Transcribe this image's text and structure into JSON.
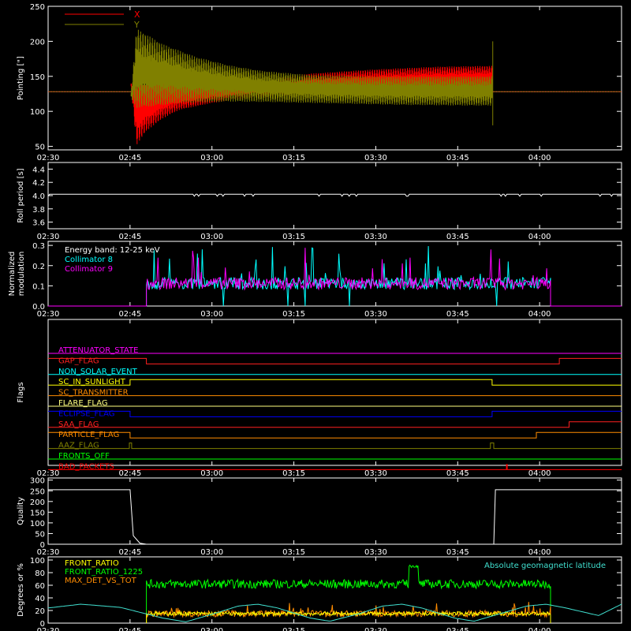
{
  "chart_data": [
    {
      "type": "line",
      "ylabel": "Pointing [\"]",
      "ylim": [
        45,
        250
      ],
      "yticks": [
        50,
        100,
        150,
        200,
        250
      ],
      "grid": false,
      "legend": "top-left",
      "series": [
        {
          "name": "X",
          "color": "#ff0000",
          "min": [
            [
              2.752,
              140
            ],
            [
              2.77,
              52
            ],
            [
              2.8,
              72
            ],
            [
              2.85,
              90
            ],
            [
              2.9,
              102
            ],
            [
              3.0,
              112
            ],
            [
              3.1,
              118
            ],
            [
              3.3,
              122
            ],
            [
              3.5,
              126
            ],
            [
              3.7,
              128
            ],
            [
              3.855,
              129
            ]
          ],
          "max": [
            [
              2.752,
              140
            ],
            [
              2.77,
              138
            ],
            [
              2.85,
              140
            ],
            [
              3.0,
              141
            ],
            [
              3.15,
              146
            ],
            [
              3.3,
              154
            ],
            [
              3.5,
              160
            ],
            [
              3.7,
              164
            ],
            [
              3.855,
              165
            ]
          ]
        },
        {
          "name": "Y",
          "color": "#808000",
          "min": [
            [
              2.752,
              120
            ],
            [
              2.77,
              105
            ],
            [
              2.9,
              112
            ],
            [
              3.05,
              114
            ],
            [
              3.2,
              113
            ],
            [
              3.4,
              111
            ],
            [
              3.6,
              109
            ],
            [
              3.855,
              108
            ]
          ],
          "max": [
            [
              2.752,
              120
            ],
            [
              2.77,
              218
            ],
            [
              2.85,
              196
            ],
            [
              2.95,
              178
            ],
            [
              3.05,
              166
            ],
            [
              3.15,
              158
            ],
            [
              3.3,
              152
            ],
            [
              3.5,
              150
            ],
            [
              3.7,
              150
            ],
            [
              3.855,
              150
            ]
          ]
        }
      ],
      "flat_value": 128,
      "xaxis_labels": [
        "02:30",
        "02:45",
        "03:00",
        "03:15",
        "03:30",
        "03:45",
        "04:00"
      ]
    },
    {
      "type": "line",
      "ylabel": "Roll period [s]",
      "ylim": [
        3.5,
        4.5
      ],
      "yticks": [
        3.6,
        3.8,
        4.0,
        4.2,
        4.4
      ],
      "series": [
        {
          "name": "",
          "color": "#ffffff",
          "x_range": [
            "02:30",
            "04:15"
          ],
          "value": 4.02
        }
      ],
      "xaxis_labels": [
        "02:30",
        "02:45",
        "03:00",
        "03:15",
        "03:30",
        "03:45",
        "04:00"
      ]
    },
    {
      "type": "line",
      "ylabel": "Normalized modulation",
      "ylim": [
        0,
        0.32
      ],
      "yticks": [
        0.0,
        0.1,
        0.2,
        0.3
      ],
      "annotation": "Energy band: 12-25 keV",
      "legend": "top-left",
      "series": [
        {
          "name": "Collimator 8",
          "color": "#00ffff",
          "baseline": 0.092,
          "x_range": [
            "02:48",
            "04:02"
          ]
        },
        {
          "name": "Collimator 9",
          "color": "#ff00ff",
          "baseline": 0.092,
          "x_range": [
            "02:48",
            "04:02"
          ]
        }
      ],
      "xaxis_labels": [
        "02:30",
        "02:45",
        "03:00",
        "03:15",
        "03:30",
        "03:45",
        "04:00"
      ]
    },
    {
      "type": "line",
      "ylabel": "Flags",
      "flags": [
        {
          "name": "ATTENUATOR_STATE",
          "color": "#ff00ff",
          "states": [
            [
              2.5,
              0
            ]
          ]
        },
        {
          "name": "GAP_FLAG",
          "color": "#ff2020",
          "states": [
            [
              2.5,
              1
            ],
            [
              2.8,
              0
            ],
            [
              4.06,
              1
            ]
          ]
        },
        {
          "name": "NON_SOLAR_EVENT",
          "color": "#00ffff",
          "states": [
            [
              2.5,
              0
            ]
          ]
        },
        {
          "name": "SC_IN_SUNLIGHT",
          "color": "#ffff00",
          "states": [
            [
              2.5,
              0
            ],
            [
              2.75,
              1
            ],
            [
              3.855,
              0
            ]
          ]
        },
        {
          "name": "SC_TRANSMITTER",
          "color": "#ff8c00",
          "states": [
            [
              2.5,
              0
            ]
          ]
        },
        {
          "name": "FLARE_FLAG",
          "color": "#ffff80",
          "states": [
            [
              2.5,
              0
            ]
          ]
        },
        {
          "name": "ECLIPSE_FLAG",
          "color": "#0000ff",
          "states": [
            [
              2.5,
              1
            ],
            [
              2.75,
              0
            ],
            [
              3.855,
              1
            ]
          ]
        },
        {
          "name": "SAA_FLAG",
          "color": "#ff2020",
          "states": [
            [
              2.5,
              0
            ],
            [
              4.09,
              1
            ]
          ]
        },
        {
          "name": "PARTICLE_FLAG",
          "color": "#ff8c00",
          "states": [
            [
              2.5,
              1
            ],
            [
              2.75,
              0
            ],
            [
              3.99,
              1
            ]
          ]
        },
        {
          "name": "AAZ_FLAG",
          "color": "#808000",
          "states": [
            [
              2.5,
              0
            ],
            [
              2.748,
              1
            ],
            [
              2.755,
              0
            ],
            [
              3.85,
              1
            ],
            [
              3.86,
              0
            ]
          ]
        },
        {
          "name": "FRONTS_OFF",
          "color": "#00ff00",
          "states": [
            [
              2.5,
              0
            ]
          ]
        },
        {
          "name": "BAD_PACKETS",
          "color": "#ff0000",
          "states": [
            [
              2.5,
              0
            ]
          ],
          "spikes": [
            3.9
          ]
        }
      ],
      "xaxis_labels": [
        "02:30",
        "02:45",
        "03:00",
        "03:15",
        "03:30",
        "03:45",
        "04:00"
      ]
    },
    {
      "type": "line",
      "ylabel": "Quality",
      "ylim": [
        0,
        310
      ],
      "yticks": [
        0,
        50,
        100,
        150,
        200,
        250,
        300
      ],
      "series": [
        {
          "name": "",
          "color": "#ffffff",
          "points": [
            [
              2.5,
              255
            ],
            [
              2.75,
              255
            ],
            [
              2.76,
              40
            ],
            [
              2.78,
              5
            ],
            [
              2.8,
              0
            ],
            [
              3.86,
              0
            ],
            [
              3.865,
              255
            ],
            [
              4.25,
              255
            ]
          ]
        }
      ],
      "xaxis_labels": [
        "02:30",
        "02:45",
        "03:00",
        "03:15",
        "03:30",
        "03:45",
        "04:00"
      ]
    },
    {
      "type": "line",
      "ylabel": "Degrees or %",
      "ylim": [
        0,
        105
      ],
      "yticks": [
        0,
        20,
        40,
        60,
        80,
        100
      ],
      "legend": "top-left",
      "series": [
        {
          "name": "FRONT_RATIO",
          "color": "#ffff00",
          "level": 15,
          "x_range": [
            "02:48",
            "04:02"
          ]
        },
        {
          "name": "FRONT_RATIO_1225",
          "color": "#00ff00",
          "level": 62,
          "x_range": [
            "02:48",
            "04:02"
          ],
          "bump": [
            [
              3.6,
              3.63,
              90
            ]
          ]
        },
        {
          "name": "MAX_DET_VS_TOT",
          "color": "#ff8c00",
          "level": 14,
          "x_range": [
            "02:48",
            "04:02"
          ]
        },
        {
          "name": "Absolute geomagnetic latitude",
          "color": "#40e0d0",
          "points": [
            [
              2.5,
              24
            ],
            [
              2.6,
              30
            ],
            [
              2.72,
              25
            ],
            [
              2.85,
              8
            ],
            [
              2.92,
              2
            ],
            [
              3.0,
              14
            ],
            [
              3.08,
              27
            ],
            [
              3.14,
              30
            ],
            [
              3.2,
              24
            ],
            [
              3.3,
              8
            ],
            [
              3.36,
              3
            ],
            [
              3.45,
              15
            ],
            [
              3.52,
              27
            ],
            [
              3.58,
              30
            ],
            [
              3.64,
              24
            ],
            [
              3.74,
              8
            ],
            [
              3.8,
              3
            ],
            [
              3.88,
              15
            ],
            [
              3.96,
              27
            ],
            [
              4.02,
              30
            ],
            [
              4.08,
              24
            ],
            [
              4.18,
              12
            ],
            [
              4.25,
              30
            ]
          ]
        }
      ],
      "xaxis_labels": [
        "02:30",
        "02:45",
        "03:00",
        "03:15",
        "03:30",
        "03:45",
        "04:00"
      ]
    }
  ]
}
